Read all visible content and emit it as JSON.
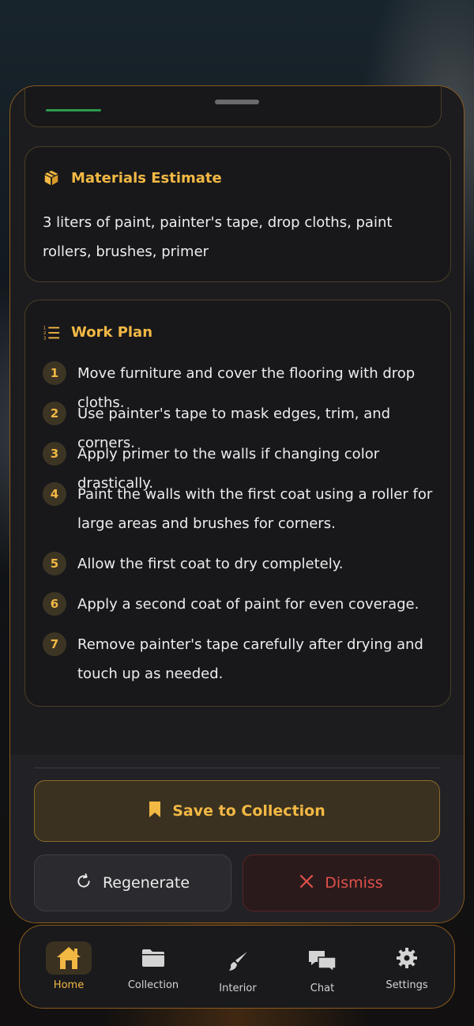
{
  "materials": {
    "title": "Materials Estimate",
    "icon": "package-icon",
    "text": "3 liters of paint, painter's tape, drop cloths, paint rollers, brushes, primer"
  },
  "work_plan": {
    "title": "Work Plan",
    "icon": "numbered-list-icon",
    "steps": [
      {
        "num": "1",
        "text": "Move furniture and cover the flooring with drop cloths."
      },
      {
        "num": "2",
        "text": "Use painter's tape to mask edges, trim, and corners."
      },
      {
        "num": "3",
        "text": "Apply primer to the walls if changing color drastically."
      },
      {
        "num": "4",
        "text": "Paint the walls with the first coat using a roller for large areas and brushes for corners."
      },
      {
        "num": "5",
        "text": "Allow the first coat to dry completely."
      },
      {
        "num": "6",
        "text": "Apply a second coat of paint for even coverage."
      },
      {
        "num": "7",
        "text": "Remove painter's tape carefully after drying and touch up as needed."
      }
    ]
  },
  "actions": {
    "save_label": "Save to Collection",
    "regenerate_label": "Regenerate",
    "dismiss_label": "Dismiss"
  },
  "tabs": [
    {
      "label": "Home",
      "icon": "home-icon",
      "active": true
    },
    {
      "label": "Collection",
      "icon": "folder-icon",
      "active": false
    },
    {
      "label": "Interior",
      "icon": "paintbrush-icon",
      "active": false
    },
    {
      "label": "Chat",
      "icon": "chat-icon",
      "active": false
    },
    {
      "label": "Settings",
      "icon": "gear-icon",
      "active": false
    }
  ],
  "colors": {
    "accent": "#f2b844",
    "danger": "#e0504a",
    "border": "#8a5a1e"
  }
}
